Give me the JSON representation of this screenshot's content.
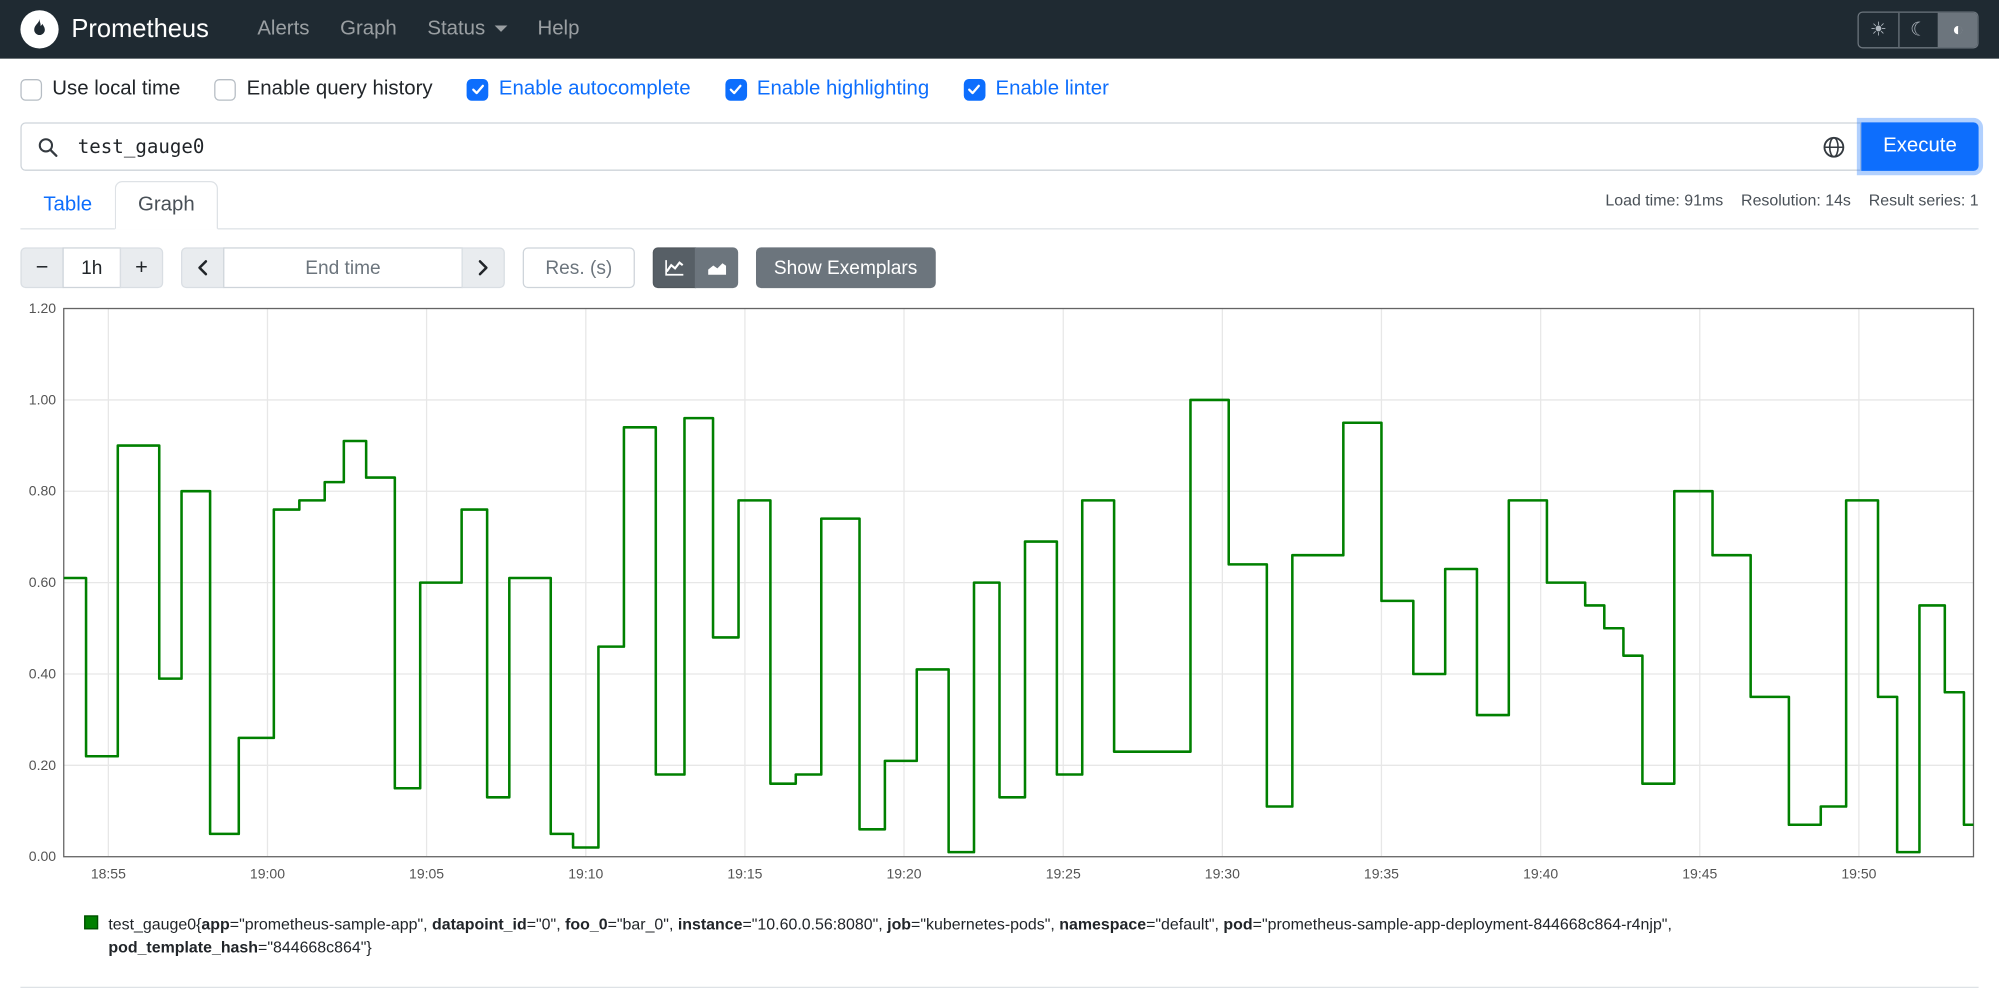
{
  "navbar": {
    "brand": "Prometheus",
    "items": [
      {
        "label": "Alerts",
        "dropdown": false
      },
      {
        "label": "Graph",
        "dropdown": false
      },
      {
        "label": "Status",
        "dropdown": true
      },
      {
        "label": "Help",
        "dropdown": false
      }
    ],
    "theme_buttons": [
      {
        "name": "theme-light-button",
        "icon": "sun-icon",
        "glyph": "☀",
        "active": false
      },
      {
        "name": "theme-dark-button",
        "icon": "moon-icon",
        "glyph": "☾",
        "active": false
      },
      {
        "name": "theme-auto-button",
        "icon": "contrast-icon",
        "glyph": "◐",
        "active": true
      }
    ]
  },
  "settings": {
    "checkboxes": [
      {
        "label": "Use local time",
        "checked": false
      },
      {
        "label": "Enable query history",
        "checked": false
      },
      {
        "label": "Enable autocomplete",
        "checked": true
      },
      {
        "label": "Enable highlighting",
        "checked": true
      },
      {
        "label": "Enable linter",
        "checked": true
      }
    ]
  },
  "query": {
    "value": "test_gauge0",
    "execute_label": "Execute"
  },
  "stats": {
    "load_time": "Load time: 91ms",
    "resolution": "Resolution: 14s",
    "result_series": "Result series: 1"
  },
  "tabs": [
    {
      "label": "Table",
      "active": false
    },
    {
      "label": "Graph",
      "active": true
    }
  ],
  "graph_controls": {
    "decrease_glyph": "−",
    "increase_glyph": "+",
    "duration_value": "1h",
    "end_time_placeholder": "End time",
    "res_placeholder": "Res. (s)",
    "show_exemplars_label": "Show Exemplars"
  },
  "chart_data": {
    "type": "line",
    "step": "after",
    "grid": true,
    "legend_position": "bottom-center",
    "series_color": "#008000",
    "xlim": [
      0,
      60
    ],
    "ylim": [
      0,
      1.2
    ],
    "x_note": "t = minutes from chart left edge (~18:53.5), 1h range",
    "x_ticks": [
      {
        "t": 1.4,
        "label": "18:55"
      },
      {
        "t": 6.4,
        "label": "19:00"
      },
      {
        "t": 11.4,
        "label": "19:05"
      },
      {
        "t": 16.4,
        "label": "19:10"
      },
      {
        "t": 21.4,
        "label": "19:15"
      },
      {
        "t": 26.4,
        "label": "19:20"
      },
      {
        "t": 31.4,
        "label": "19:25"
      },
      {
        "t": 36.4,
        "label": "19:30"
      },
      {
        "t": 41.4,
        "label": "19:35"
      },
      {
        "t": 46.4,
        "label": "19:40"
      },
      {
        "t": 51.4,
        "label": "19:45"
      },
      {
        "t": 56.4,
        "label": "19:50"
      }
    ],
    "y_ticks": [
      {
        "v": 0.0,
        "label": "0.00"
      },
      {
        "v": 0.2,
        "label": "0.20"
      },
      {
        "v": 0.4,
        "label": "0.40"
      },
      {
        "v": 0.6,
        "label": "0.60"
      },
      {
        "v": 0.8,
        "label": "0.80"
      },
      {
        "v": 1.0,
        "label": "1.00"
      },
      {
        "v": 1.2,
        "label": "1.20"
      }
    ],
    "series": [
      {
        "name": "test_gauge0",
        "points": [
          [
            0.0,
            0.61
          ],
          [
            0.7,
            0.22
          ],
          [
            1.7,
            0.9
          ],
          [
            3.0,
            0.39
          ],
          [
            3.7,
            0.8
          ],
          [
            4.6,
            0.05
          ],
          [
            5.5,
            0.26
          ],
          [
            6.6,
            0.76
          ],
          [
            7.4,
            0.78
          ],
          [
            8.2,
            0.82
          ],
          [
            8.8,
            0.91
          ],
          [
            9.5,
            0.83
          ],
          [
            10.4,
            0.15
          ],
          [
            11.2,
            0.6
          ],
          [
            12.5,
            0.76
          ],
          [
            13.3,
            0.13
          ],
          [
            14.0,
            0.61
          ],
          [
            15.3,
            0.05
          ],
          [
            16.0,
            0.02
          ],
          [
            16.8,
            0.46
          ],
          [
            17.6,
            0.94
          ],
          [
            18.6,
            0.18
          ],
          [
            19.5,
            0.96
          ],
          [
            20.4,
            0.48
          ],
          [
            21.2,
            0.78
          ],
          [
            22.2,
            0.16
          ],
          [
            23.0,
            0.18
          ],
          [
            23.8,
            0.74
          ],
          [
            25.0,
            0.06
          ],
          [
            25.8,
            0.21
          ],
          [
            26.8,
            0.41
          ],
          [
            27.8,
            0.01
          ],
          [
            28.6,
            0.6
          ],
          [
            29.4,
            0.13
          ],
          [
            30.2,
            0.69
          ],
          [
            31.2,
            0.18
          ],
          [
            32.0,
            0.78
          ],
          [
            33.0,
            0.23
          ],
          [
            35.4,
            1.0
          ],
          [
            36.6,
            0.64
          ],
          [
            37.8,
            0.11
          ],
          [
            38.6,
            0.66
          ],
          [
            40.2,
            0.95
          ],
          [
            41.4,
            0.56
          ],
          [
            42.4,
            0.4
          ],
          [
            43.4,
            0.63
          ],
          [
            44.4,
            0.31
          ],
          [
            45.4,
            0.78
          ],
          [
            46.6,
            0.6
          ],
          [
            47.8,
            0.55
          ],
          [
            48.4,
            0.5
          ],
          [
            49.0,
            0.44
          ],
          [
            49.6,
            0.16
          ],
          [
            50.6,
            0.8
          ],
          [
            51.8,
            0.66
          ],
          [
            53.0,
            0.35
          ],
          [
            54.2,
            0.07
          ],
          [
            55.2,
            0.11
          ],
          [
            56.0,
            0.78
          ],
          [
            57.0,
            0.35
          ],
          [
            57.6,
            0.01
          ],
          [
            58.3,
            0.55
          ],
          [
            59.1,
            0.36
          ],
          [
            59.7,
            0.07
          ]
        ]
      }
    ]
  },
  "legend": {
    "metric": "test_gauge0",
    "labels": [
      {
        "k": "app",
        "v": "prometheus-sample-app"
      },
      {
        "k": "datapoint_id",
        "v": "0"
      },
      {
        "k": "foo_0",
        "v": "bar_0"
      },
      {
        "k": "instance",
        "v": "10.60.0.56:8080"
      },
      {
        "k": "job",
        "v": "kubernetes-pods"
      },
      {
        "k": "namespace",
        "v": "default"
      },
      {
        "k": "pod",
        "v": "prometheus-sample-app-deployment-844668c864-r4njp"
      },
      {
        "k": "pod_template_hash",
        "v": "844668c864"
      }
    ]
  }
}
